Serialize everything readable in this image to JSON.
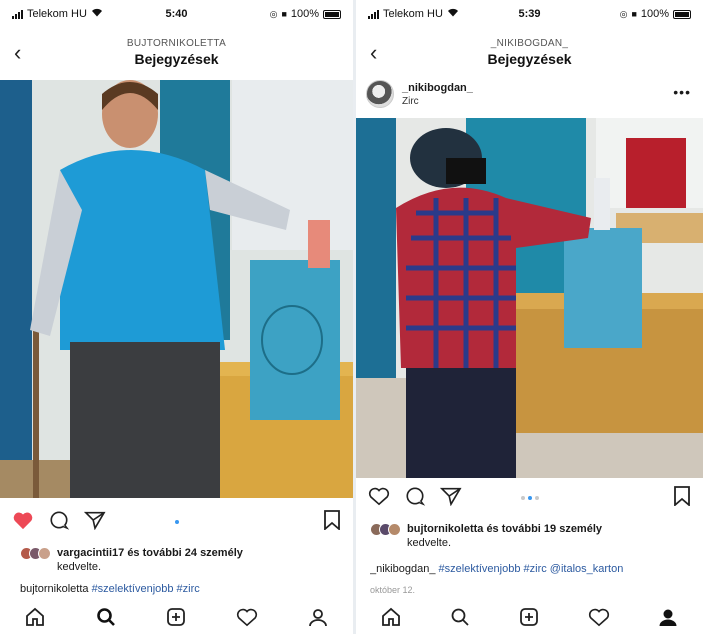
{
  "left": {
    "status": {
      "carrier": "Telekom HU",
      "time": "5:40",
      "battery": "100%"
    },
    "header": {
      "account": "BUJTORNIKOLETTA",
      "title": "Bejegyzések",
      "back": "‹"
    },
    "likes": {
      "text": "vargacintii17 és további 24 személy",
      "text2": "kedvelte."
    },
    "caption": {
      "user": "bujtornikoletta",
      "tags": "#szelektívenjobb #zirc"
    },
    "liked": true
  },
  "right": {
    "status": {
      "carrier": "Telekom HU",
      "time": "5:39",
      "battery": "100%"
    },
    "header": {
      "account": "_NIKIBOGDAN_",
      "title": "Bejegyzések",
      "back": "‹"
    },
    "post": {
      "user": "_nikibogdan_",
      "location": "Zirc",
      "more": "•••"
    },
    "likes": {
      "text": "bujtornikoletta és további 19 személy",
      "text2": "kedvelte."
    },
    "caption": {
      "user": "_nikibogdan_",
      "tags": "#szelektívenjobb #zirc @italos_karton"
    },
    "date": "október 12."
  },
  "colors": {
    "accent": "#3897f0",
    "like_red": "#ed4956",
    "tag_blue": "#2c5aa0"
  },
  "icons": [
    "home-icon",
    "search-icon",
    "add-icon",
    "heart-icon",
    "profile-icon"
  ]
}
